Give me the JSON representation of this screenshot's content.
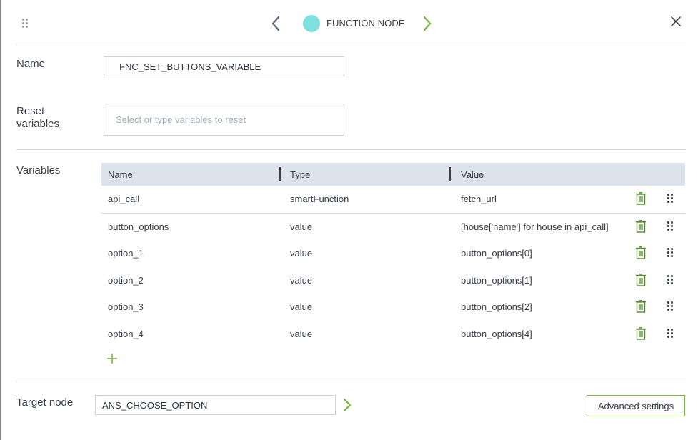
{
  "header": {
    "node_type": "FUNCTION NODE",
    "node_color": "#7fe0df",
    "icons": {
      "drag": "drag-handle-icon",
      "prev": "chevron-left-icon",
      "next": "chevron-right-icon",
      "close": "close-icon"
    }
  },
  "name_field": {
    "label": "Name",
    "value": "FNC_SET_BUTTONS_VARIABLE"
  },
  "reset_field": {
    "label_line1": "Reset",
    "label_line2": "variables",
    "placeholder": "Select or type variables to reset"
  },
  "variables": {
    "label": "Variables",
    "columns": [
      "Name",
      "Type",
      "Value"
    ],
    "rows": [
      {
        "name": "api_call",
        "type": "smartFunction",
        "value": "fetch_url"
      },
      {
        "name": "button_options",
        "type": "value",
        "value": "[house['name'] for house in api_call]"
      },
      {
        "name": "option_1",
        "type": "value",
        "value": "button_options[0]"
      },
      {
        "name": "option_2",
        "type": "value",
        "value": "button_options[1]"
      },
      {
        "name": "option_3",
        "type": "value",
        "value": "button_options[2]"
      },
      {
        "name": "option_4",
        "type": "value",
        "value": "button_options[4]"
      }
    ],
    "row_icons": {
      "delete": "trash-icon",
      "reorder": "grip-icon"
    },
    "add_icon": "plus-icon"
  },
  "target": {
    "label": "Target node",
    "value": "ANS_CHOOSE_OPTION",
    "go_icon": "chevron-right-icon"
  },
  "advanced_button": {
    "label": "Advanced settings"
  },
  "colors": {
    "accent_green": "#7cb342",
    "header_bg": "#dde3ec",
    "text": "#3a3f4a"
  }
}
